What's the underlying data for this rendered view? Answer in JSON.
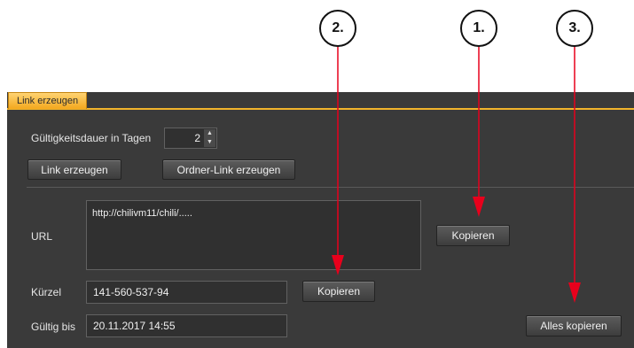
{
  "callouts": {
    "c1": "1.",
    "c2": "2.",
    "c3": "3."
  },
  "tab": {
    "label": "Link erzeugen"
  },
  "validity": {
    "label": "Gültigkeitsdauer in Tagen",
    "value": "2"
  },
  "buttons": {
    "create_link": "Link erzeugen",
    "create_folder_link": "Ordner-Link erzeugen",
    "copy_url": "Kopieren",
    "copy_short": "Kopieren",
    "copy_all": "Alles kopieren"
  },
  "url": {
    "label": "URL",
    "value": "http://chilivm11/chili/....."
  },
  "short": {
    "label": "Kürzel",
    "value": "141-560-537-94"
  },
  "valid_until": {
    "label": "Gültig bis",
    "value": "20.11.2017 14:55"
  },
  "colors": {
    "accent": "#f1b42c",
    "arrow": "#e8001c",
    "panel": "#3a3a3a"
  },
  "icons": {
    "spinner": "up-down-arrows-icon"
  }
}
